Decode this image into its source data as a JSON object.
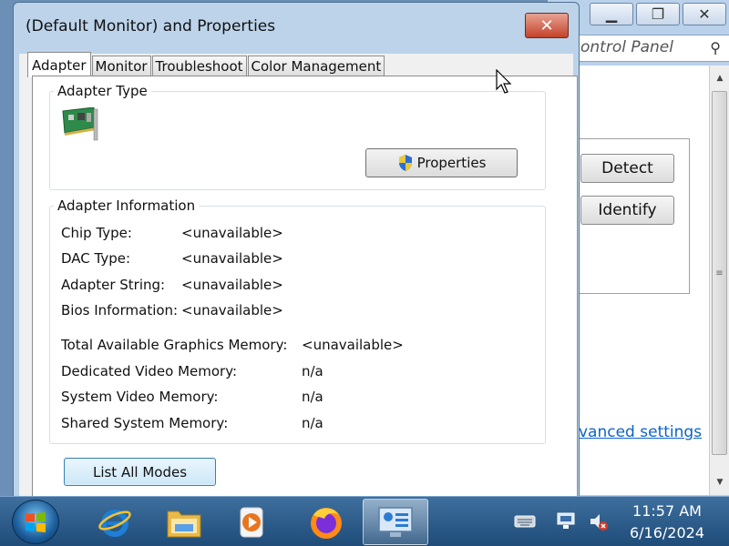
{
  "dialog": {
    "title": "(Default Monitor) and  Properties",
    "close_label": "✕",
    "tabs": [
      {
        "label": "Adapter"
      },
      {
        "label": "Monitor"
      },
      {
        "label": "Troubleshoot"
      },
      {
        "label": "Color Management"
      }
    ],
    "adapter_type": {
      "label": "Adapter Type",
      "properties_button": "Properties"
    },
    "adapter_info": {
      "label": "Adapter Information",
      "rows": [
        {
          "key": "Chip Type:",
          "value": "<unavailable>"
        },
        {
          "key": "DAC Type:",
          "value": "<unavailable>"
        },
        {
          "key": "Adapter String:",
          "value": "<unavailable>"
        },
        {
          "key": "Bios Information:",
          "value": "<unavailable>"
        }
      ],
      "memory_rows": [
        {
          "key": "Total Available Graphics Memory:",
          "value": "<unavailable>"
        },
        {
          "key": "Dedicated Video Memory:",
          "value": "n/a"
        },
        {
          "key": "System Video Memory:",
          "value": "n/a"
        },
        {
          "key": "Shared System Memory:",
          "value": "n/a"
        }
      ]
    },
    "list_modes_button": "List All Modes"
  },
  "background_window": {
    "address_text": "ontrol Panel",
    "detect_button": "Detect",
    "identify_button": "Identify",
    "advanced_link": "vanced settings"
  },
  "taskbar": {
    "time": "11:57 AM",
    "date": "6/16/2024",
    "apps": [
      "internet-explorer-icon",
      "file-explorer-icon",
      "media-player-icon",
      "firefox-icon",
      "display-settings-icon"
    ]
  },
  "colors": {
    "title_close": "#c4422b",
    "link": "#0b63c8",
    "taskbar": "#1f4c79"
  }
}
